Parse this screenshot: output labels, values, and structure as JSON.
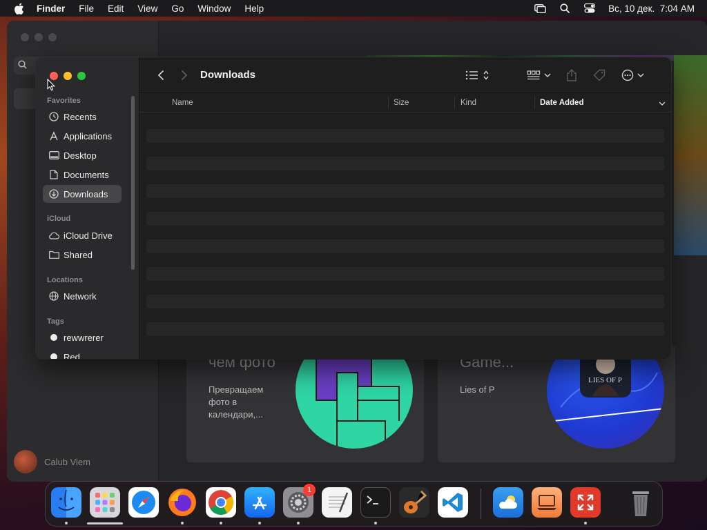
{
  "menubar": {
    "app_name": "Finder",
    "items": [
      "File",
      "Edit",
      "View",
      "Go",
      "Window",
      "Help"
    ],
    "clock": "Вс, 10 дек.  7:04 AM"
  },
  "background_app": {
    "user_name": "Calub Viem",
    "cards": [
      {
        "title": "чем фото",
        "subtitle": "Превращаем фото в календари,..."
      },
      {
        "title": "Game...",
        "subtitle": "Lies of P"
      }
    ],
    "art_text": "LIES OF P"
  },
  "finder": {
    "title": "Downloads",
    "sidebar": {
      "favorites_label": "Favorites",
      "favorites": [
        "Recents",
        "Applications",
        "Desktop",
        "Documents",
        "Downloads"
      ],
      "icloud_label": "iCloud",
      "icloud": [
        "iCloud Drive",
        "Shared"
      ],
      "locations_label": "Locations",
      "locations": [
        "Network"
      ],
      "tags_label": "Tags",
      "tags": [
        "rewwrerer",
        "Red"
      ],
      "selected": "Downloads"
    },
    "columns": {
      "name": "Name",
      "size": "Size",
      "kind": "Kind",
      "date_added": "Date Added"
    },
    "empty_rows": 8
  },
  "dock": {
    "apps": [
      "Finder",
      "Launchpad",
      "Safari",
      "Firefox",
      "Chrome",
      "App Store",
      "System Settings",
      "TextEdit",
      "Terminal",
      "GarageBand",
      "Visual Studio Code",
      "Weather",
      "Screen Sharing",
      "Remote Desktop",
      "Trash"
    ],
    "system_settings_badge": "1"
  },
  "colors": {
    "accent_close": "#ff5f57",
    "accent_minimize": "#febc2e",
    "accent_maximize": "#28c840",
    "sidebar_bg": "#2a2a2c",
    "content_bg": "#1e1e1e"
  }
}
